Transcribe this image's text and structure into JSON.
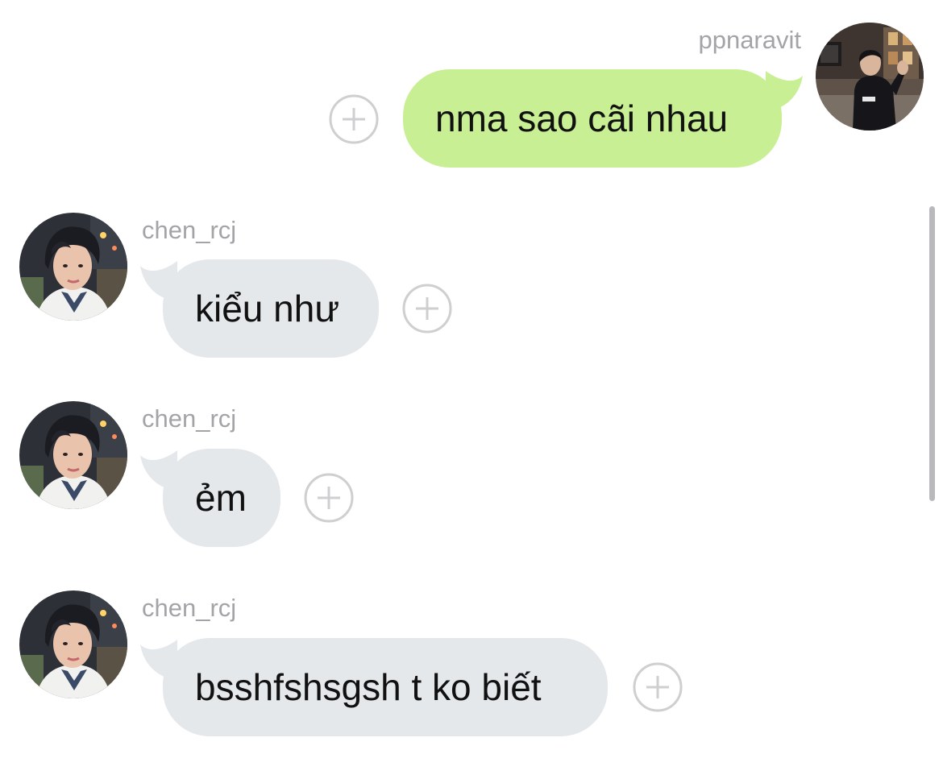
{
  "thread": {
    "messages": [
      {
        "direction": "outgoing",
        "username": "ppnaravit",
        "text": "nma sao cãi nhau",
        "avatar": "profile-photo"
      },
      {
        "direction": "incoming",
        "username": "chen_rcj",
        "text": "kiểu như",
        "avatar": "profile-photo"
      },
      {
        "direction": "incoming",
        "username": "chen_rcj",
        "text": "ẻm",
        "avatar": "profile-photo"
      },
      {
        "direction": "incoming",
        "username": "chen_rcj",
        "text": "bsshfshsgsh t ko biết",
        "avatar": "profile-photo"
      }
    ],
    "react_icon": "plus-circle-icon"
  },
  "colors": {
    "outgoing_bubble": "#c9ef95",
    "incoming_bubble": "#e5e8eb",
    "username_text": "#a4a4a8",
    "message_text": "#111111",
    "react_icon_stroke": "#cfcfd2",
    "scrollbar": "#b9b9bd"
  }
}
